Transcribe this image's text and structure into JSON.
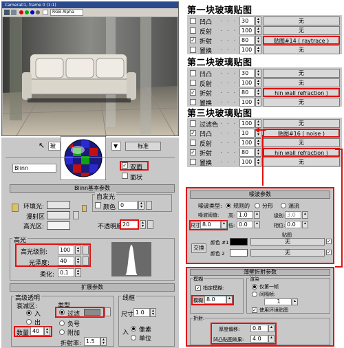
{
  "viewport": {
    "title": "Camera01, frame 0 (1:1)",
    "channel": "RGB Alpha"
  },
  "material_editor": {
    "type_button": "标准",
    "shader": "Blinn",
    "two_sided_label": "双面",
    "faceted_label": "面状",
    "blinn_header": "Blinn基本参数",
    "self_illum_label": "自发光",
    "color_label": "颜色",
    "color_value": "0",
    "ambient_label": "环境光:",
    "diffuse_label": "漫射区",
    "specular_label": "高光区:",
    "opacity_label": "不透明度",
    "opacity_value": "20",
    "highlight_group": "高光",
    "spec_level_label": "高光级别:",
    "spec_level_value": "100",
    "gloss_label": "光泽度:",
    "gloss_value": "40",
    "soften_label": "柔化:",
    "soften_value": "0.1",
    "extended_header": "扩展参数",
    "adv_transp_label": "高级透明",
    "falloff_label": "衰减区:",
    "in_label": "入",
    "out_label": "出",
    "amount_label": "数量",
    "amount_value": "40",
    "type_label": "类型",
    "filter_label": "过滤",
    "subtractive_label": "负号",
    "additive_label": "附加",
    "ior_label": "折射率:",
    "ior_value": "1.5",
    "wire_label": "线框",
    "size_label": "尺寸",
    "size_value": "1.0",
    "in2_label": "入",
    "pixels_label": "像素",
    "units_label": "单位"
  },
  "glass1": {
    "title": "第一块玻璃贴图",
    "rows": [
      {
        "label": "凹凸",
        "value": "30",
        "map": "无",
        "checked": false,
        "red": false
      },
      {
        "label": "反射",
        "value": "100",
        "map": "无",
        "checked": false,
        "red": false
      },
      {
        "label": "折射",
        "value": "80",
        "map": "贴图#14  ( raytrace )",
        "checked": true,
        "red": true
      },
      {
        "label": "置换",
        "value": "100",
        "map": "无",
        "checked": false,
        "red": false
      }
    ]
  },
  "glass2": {
    "title": "第二块玻璃贴图",
    "rows": [
      {
        "label": "凹凸",
        "value": "30",
        "map": "无",
        "checked": false,
        "red": false
      },
      {
        "label": "反射",
        "value": "100",
        "map": "无",
        "checked": false,
        "red": false
      },
      {
        "label": "折射",
        "value": "80",
        "map": "hin wall refraction )",
        "checked": true,
        "red": true
      },
      {
        "label": "置换",
        "value": "100",
        "map": "无",
        "checked": false,
        "red": false
      }
    ]
  },
  "glass3": {
    "title": "第三块玻璃贴图",
    "rows": [
      {
        "label": "过滤色",
        "value": "100",
        "map": "无",
        "checked": false,
        "red": false
      },
      {
        "label": "凹凸",
        "value": "10",
        "map": "贴图#16  ( noise )",
        "checked": true,
        "red": true
      },
      {
        "label": "反射",
        "value": "100",
        "map": "无",
        "checked": false,
        "red": false
      },
      {
        "label": "折射",
        "value": "80",
        "map": "hin wall refraction )",
        "checked": true,
        "red": true
      },
      {
        "label": "置换",
        "value": "100",
        "map": "无",
        "checked": false,
        "red": false
      }
    ]
  },
  "noise": {
    "header": "噪波参数",
    "type_label": "噪波类型:",
    "regular": "规则的",
    "fractal": "分形",
    "turbulence": "湍流",
    "threshold_label": "噪波阈值:",
    "high_label": "高:",
    "high_value": "1.0",
    "levels_label": "级别:",
    "levels_value": "3.0",
    "size_label": "尺寸",
    "size_value": "8.0",
    "low_label": "低:",
    "low_value": "0.0",
    "phase_label": "相位:",
    "phase_value": "0.0",
    "maps_label": "贴图",
    "swap_button": "交换",
    "color1_label": "颜色 #1",
    "color2_label": "颜色 2",
    "none1": "无",
    "none2": "无"
  },
  "refract": {
    "header": "薄壁折射参数",
    "blur_group": "模糊",
    "apply_blur_label": "指定模糊:",
    "blur_label": "模糊",
    "blur_value": "8.0",
    "render_group": "渲染",
    "first_frame_label": "仅第一帧",
    "every_n_label": "间隔帧:",
    "every_n_value": "1",
    "env_map_label": "使用环境贴图",
    "refraction_group": "折射:",
    "thickness_label": "厚度偏移:",
    "thickness_value": "0.8",
    "bump_label": "凹凸贴图效果:",
    "bump_value": "4.0"
  }
}
